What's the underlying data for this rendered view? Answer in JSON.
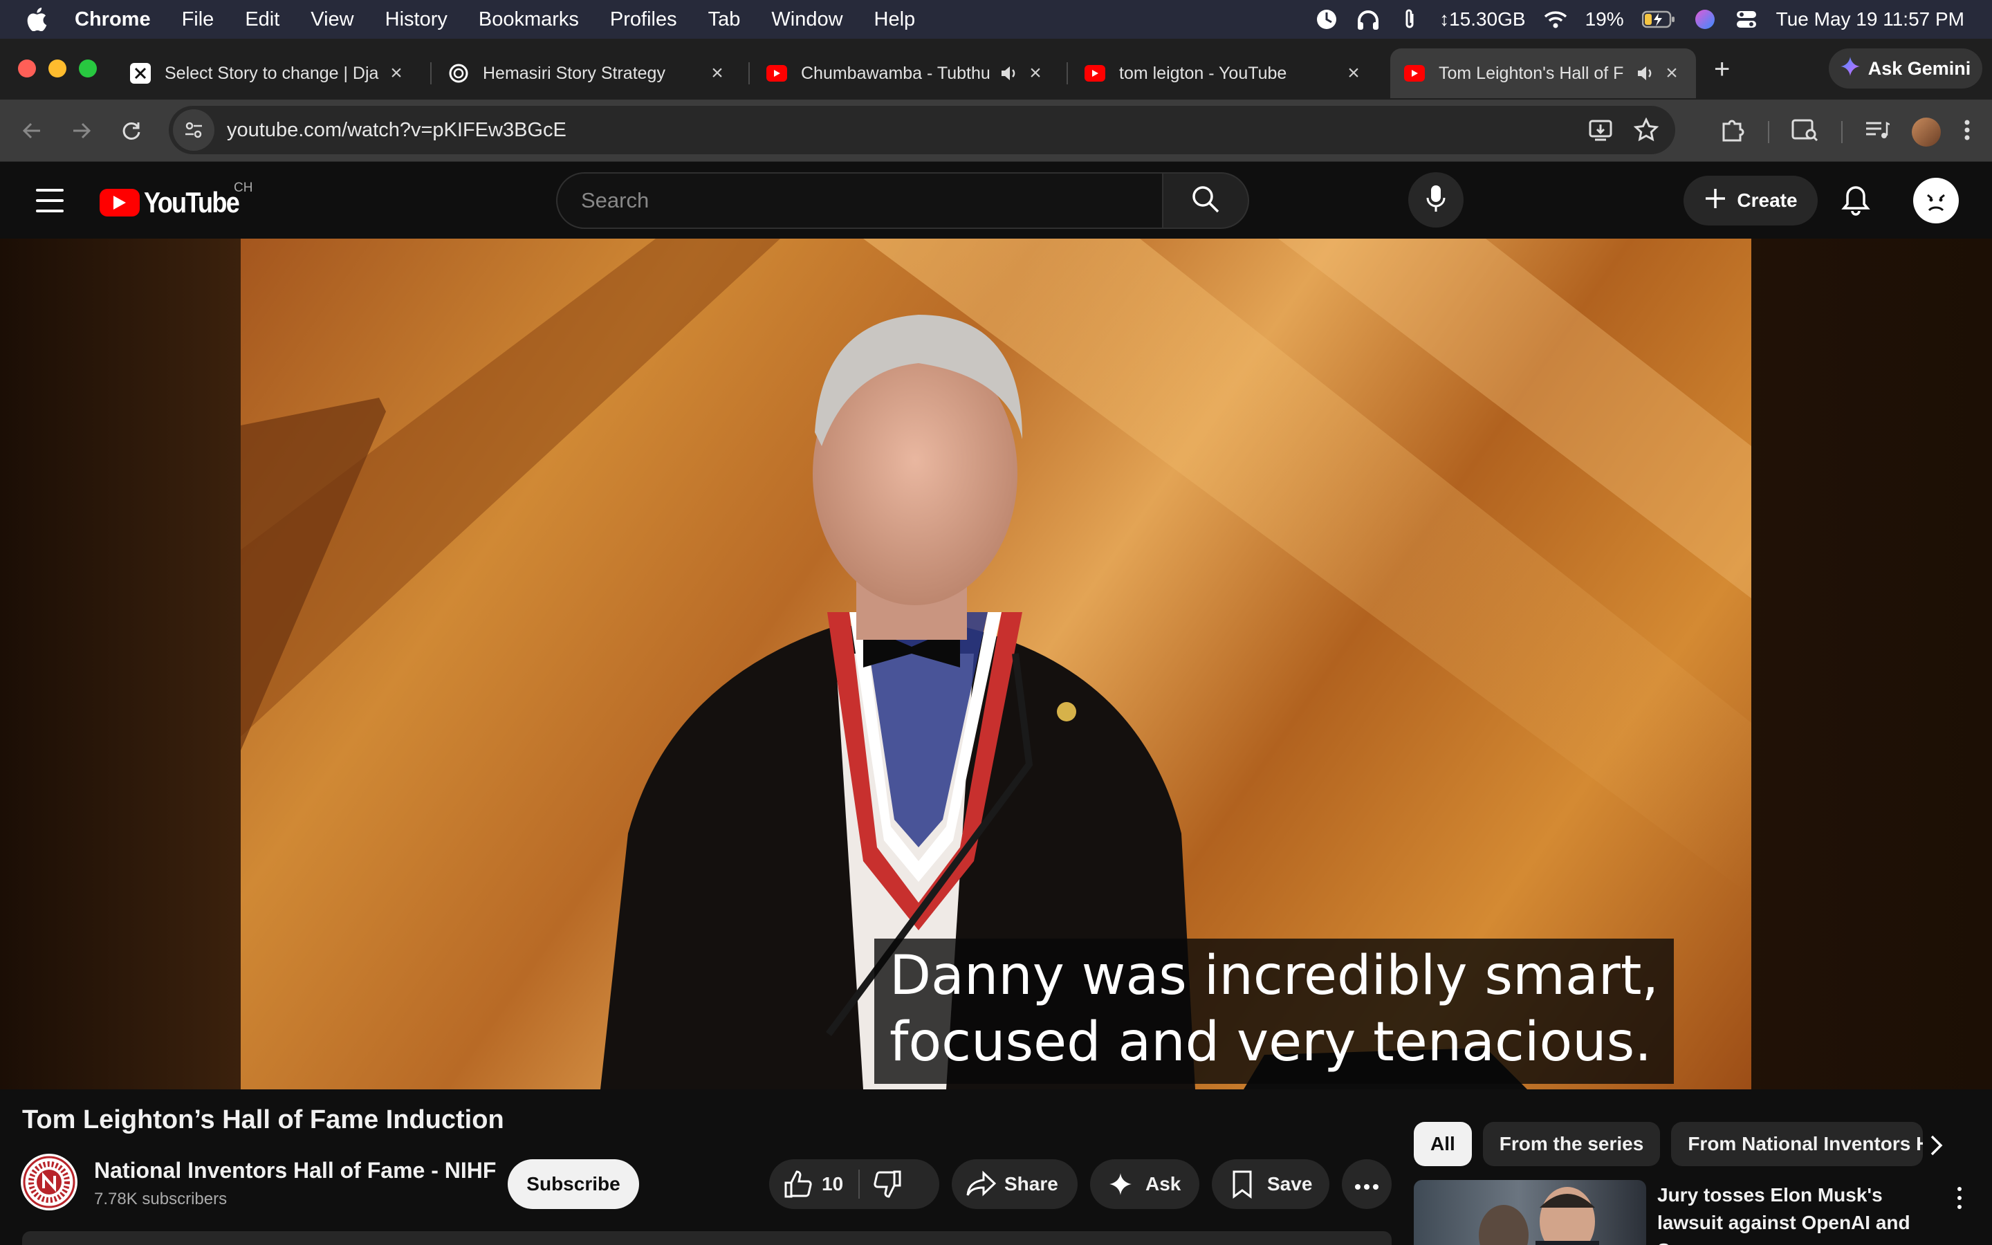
{
  "menubar": {
    "app": "Chrome",
    "items": [
      "File",
      "Edit",
      "View",
      "History",
      "Bookmarks",
      "Profiles",
      "Tab",
      "Window",
      "Help"
    ],
    "memory": "↕15.30GB",
    "battery": "19%",
    "datetime": "Tue May 19  11:57 PM"
  },
  "tabs": [
    {
      "label": "Select Story to change | Dja",
      "favicon": "django-icon"
    },
    {
      "label": "Hemasiri Story Strategy",
      "favicon": "openai-icon"
    },
    {
      "label": "Chumbawamba - Tubthu",
      "favicon": "youtube-icon",
      "audio": true
    },
    {
      "label": "tom leigton - YouTube",
      "favicon": "youtube-icon"
    },
    {
      "label": "Tom Leighton's Hall of F",
      "favicon": "youtube-icon",
      "audio": true,
      "active": true
    }
  ],
  "gemini": {
    "label": "Ask Gemini"
  },
  "address": {
    "url": "youtube.com/watch?v=pKIFEw3BGcE"
  },
  "youtube": {
    "logo_text": "YouTube",
    "country": "CH",
    "search_placeholder": "Search",
    "create_label": "Create"
  },
  "video": {
    "caption_line1": "Danny was incredibly smart,",
    "caption_line2": "focused and very tenacious.",
    "title": "Tom Leighton’s Hall of Fame Induction"
  },
  "channel": {
    "name": "National Inventors Hall of Fame - NIHF",
    "subscribers": "7.78K subscribers",
    "subscribe_label": "Subscribe"
  },
  "actions": {
    "like_count": "10",
    "share_label": "Share",
    "ask_label": "Ask",
    "save_label": "Save"
  },
  "chips": [
    "All",
    "From the series",
    "From National Inventors H"
  ],
  "recommendation": {
    "title": "Jury tosses Elon Musk's lawsuit against OpenAI and Sam ..."
  },
  "colors": {
    "yt_red": "#ff0000",
    "tab_active": "#3c3c3c",
    "menubar": "#272a3a"
  }
}
